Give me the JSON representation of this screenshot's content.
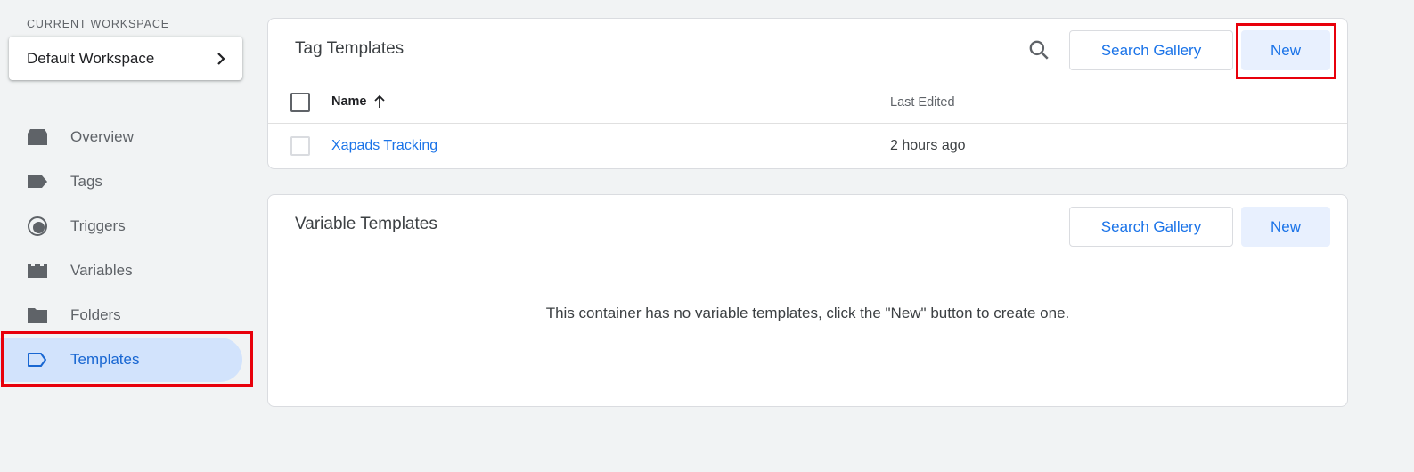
{
  "sidebar": {
    "workspace_label": "CURRENT WORKSPACE",
    "workspace_name": "Default Workspace",
    "items": [
      {
        "label": "Overview",
        "icon": "overview-icon"
      },
      {
        "label": "Tags",
        "icon": "tag-icon"
      },
      {
        "label": "Triggers",
        "icon": "trigger-icon"
      },
      {
        "label": "Variables",
        "icon": "variables-icon"
      },
      {
        "label": "Folders",
        "icon": "folder-icon"
      },
      {
        "label": "Templates",
        "icon": "template-icon",
        "active": true
      }
    ]
  },
  "tag_templates": {
    "title": "Tag Templates",
    "search_gallery_label": "Search Gallery",
    "new_label": "New",
    "columns": {
      "name": "Name",
      "last_edited": "Last Edited"
    },
    "sort_icon": "arrow-up-icon",
    "rows": [
      {
        "name": "Xapads Tracking",
        "last_edited": "2 hours ago"
      }
    ]
  },
  "variable_templates": {
    "title": "Variable Templates",
    "search_gallery_label": "Search Gallery",
    "new_label": "New",
    "empty_message": "This container has no variable templates, click the \"New\" button to create one."
  },
  "colors": {
    "accent": "#1a73e8",
    "active_nav_bg": "#d2e3fc",
    "highlight": "#e8000b",
    "background": "#f1f3f4"
  }
}
